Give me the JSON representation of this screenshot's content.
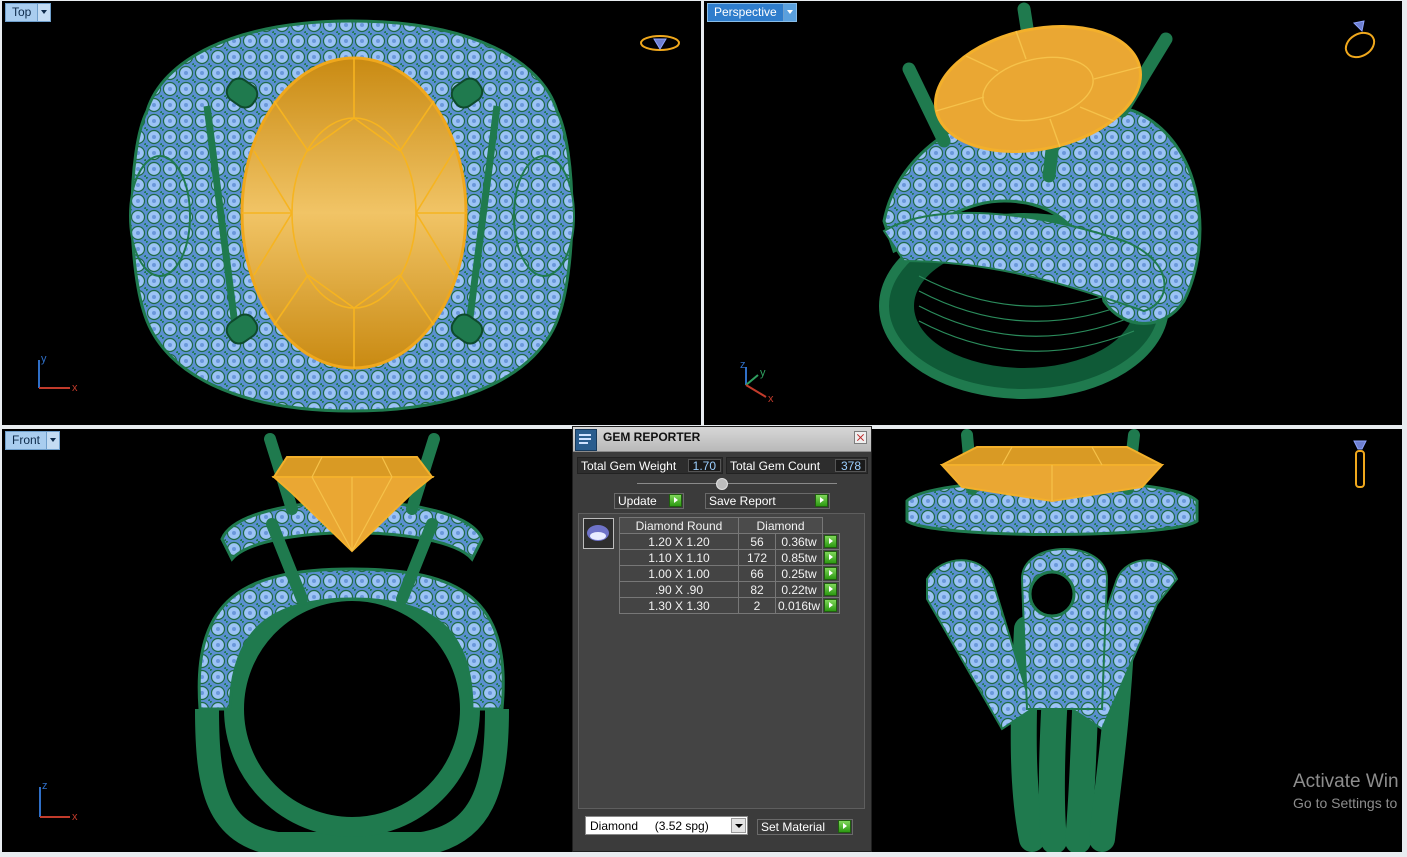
{
  "viewports": {
    "top": {
      "label": "Top",
      "axis_a": "y",
      "axis_b": "x"
    },
    "perspective": {
      "label": "Perspective",
      "axis_a": "z",
      "axis_b": "y",
      "axis_c": "x"
    },
    "front": {
      "label": "Front",
      "axis_a": "z",
      "axis_b": "x"
    }
  },
  "gem_reporter": {
    "title": "GEM REPORTER",
    "total_weight_label": "Total Gem Weight",
    "total_weight_value": "1.70",
    "total_count_label": "Total Gem Count",
    "total_count_value": "378",
    "update_label": "Update",
    "save_report_label": "Save Report",
    "table": {
      "header_shape": "Diamond Round",
      "header_material": "Diamond",
      "rows": [
        {
          "size": "1.20 X 1.20",
          "count": "56",
          "weight": "0.36tw"
        },
        {
          "size": "1.10 X 1.10",
          "count": "172",
          "weight": "0.85tw"
        },
        {
          "size": "1.00 X 1.00",
          "count": "66",
          "weight": "0.25tw"
        },
        {
          "size": ".90 X .90",
          "count": "82",
          "weight": "0.22tw"
        },
        {
          "size": "1.30 X 1.30",
          "count": "2",
          "weight": "0.016tw"
        }
      ]
    },
    "material_select_value": "Diamond     (3.52 spg)",
    "set_material_label": "Set Material"
  },
  "watermark": {
    "line1": "Activate Win",
    "line2": "Go to Settings to"
  },
  "colors": {
    "metal": "#1f7a4e",
    "gem_pave": "#8fb8f2",
    "center_stone": "#f0ad24",
    "viewport_bg": "#000000",
    "active_tab": "#2f7dcc"
  }
}
